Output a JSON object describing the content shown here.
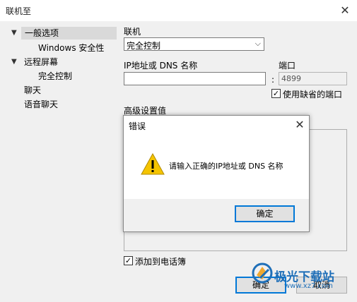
{
  "window": {
    "title": "联机至",
    "close_glyph": "✕"
  },
  "tree": {
    "items": [
      {
        "label": "一般选项",
        "expanded": true,
        "selected": true
      },
      {
        "label": "Windows 安全性"
      },
      {
        "label": "远程屏幕",
        "expanded": true
      },
      {
        "label": "完全控制"
      },
      {
        "label": "聊天"
      },
      {
        "label": "语音聊天"
      }
    ]
  },
  "form": {
    "connect_label": "联机",
    "connect_value": "完全控制",
    "ip_label": "IP地址或 DNS 名称",
    "ip_value": "",
    "port_label": "端口",
    "port_sep": ":",
    "port_value": "4899",
    "default_port_label": "使用缺省的端口",
    "default_port_checked": true,
    "advanced_label": "高级设置值",
    "add_phonebook_label": "添加到电话簿",
    "add_phonebook_checked": true,
    "ok_label": "确定",
    "cancel_label": "取消"
  },
  "dialog": {
    "title": "错误",
    "close_glyph": "✕",
    "message": "请输入正确的IP地址或 DNS 名称",
    "ok_label": "确定",
    "icon": "warning-icon"
  },
  "watermark": {
    "name": "极光下载站",
    "url": "www.xz7.com"
  },
  "colors": {
    "accent": "#0078d7",
    "warning": "#f5c400"
  }
}
